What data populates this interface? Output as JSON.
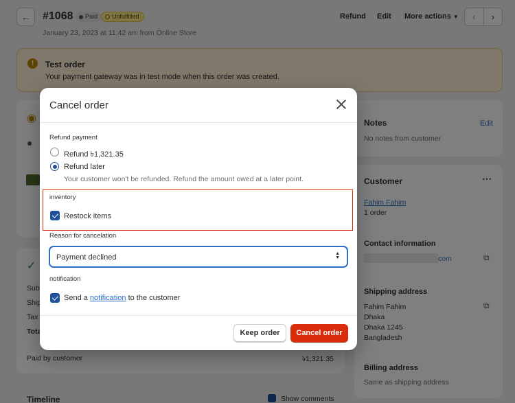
{
  "header": {
    "order_number": "#1068",
    "badges": {
      "paid": "Paid",
      "fulfillment": "Unfulfilled"
    },
    "date": "January 23, 2023 at 11:42 am from Online Store",
    "actions": {
      "refund": "Refund",
      "edit": "Edit",
      "more": "More actions"
    }
  },
  "banner": {
    "title": "Test order",
    "text": "Your payment gateway was in test mode when this order was created."
  },
  "notes": {
    "title": "Notes",
    "edit": "Edit",
    "text": "No notes from customer"
  },
  "customer": {
    "title": "Customer",
    "name": "Fahim Fahim",
    "orders": "1 order"
  },
  "contact": {
    "title": "Contact information",
    "email_tail": "com"
  },
  "shipping": {
    "title": "Shipping address",
    "lines": [
      "Fahim Fahim",
      "Dhaka",
      "Dhaka 1245",
      "Bangladesh"
    ]
  },
  "billing": {
    "title": "Billing address",
    "text": "Same as shipping address"
  },
  "summary": {
    "rows": [
      "Subt",
      "Ship",
      "Tax",
      "Tota"
    ],
    "paid_by_label": "Paid by customer",
    "paid_by_value": "৳1,321.35"
  },
  "timeline": {
    "title": "Timeline",
    "show_comments": "Show comments"
  },
  "modal": {
    "title": "Cancel order",
    "refund_section": "Refund payment",
    "refund_now": "Refund ৳1,321.35",
    "refund_later": "Refund later",
    "refund_later_help": "Your customer won't be refunded. Refund the amount owed at a later point.",
    "inventory_section": "inventory",
    "restock": "Restock items",
    "reason_section": "Reason for cancelation",
    "reason_value": "Payment declined",
    "notification_section": "notification",
    "notify_prefix": "Send a ",
    "notify_link": "notification",
    "notify_suffix": " to the customer",
    "keep_button": "Keep order",
    "cancel_button": "Cancel order"
  },
  "colors": {
    "primary": "#1f5199",
    "danger": "#d82c0d",
    "link": "#2c6ecb"
  }
}
